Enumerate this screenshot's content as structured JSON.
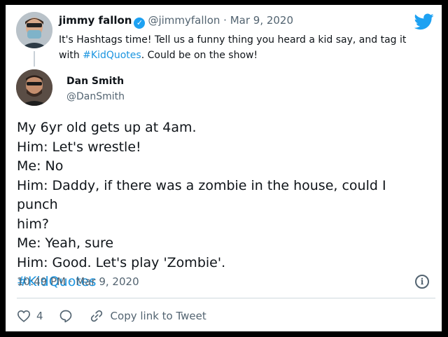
{
  "parent_tweet": {
    "author_name": "jimmy fallon",
    "handle_date": "@jimmyfallon · Mar 9, 2020",
    "text_line1": "It's Hashtags time! Tell us a funny thing you heard a kid say, and tag it",
    "text_line2_prefix": "with ",
    "hashtag": "#KidQuotes",
    "text_line2_suffix": ". Could be on the show!",
    "avatar_icon": "person-avatar-icon"
  },
  "reply_tweet": {
    "author_name": "Dan Smith",
    "handle": "@DanSmith",
    "lines": [
      "My 6yr old gets up at 4am.",
      "Him: Let's wrestle!",
      "Me: No",
      "Him: Daddy, if there was a zombie in the house, could I punch",
      "him?",
      "Me: Yeah, sure",
      "Him: Good. Let's play 'Zombie'."
    ],
    "hashtag": "#KidQuotes",
    "timestamp": "10:49 PM · Mar 9, 2020"
  },
  "actions": {
    "like_count": "4",
    "copy_link_label": "Copy link to Tweet"
  },
  "colors": {
    "brand_blue": "#1da1f2",
    "hashtag_blue": "#1b95e0",
    "text_dark": "#0f1419",
    "text_gray": "#536471"
  }
}
